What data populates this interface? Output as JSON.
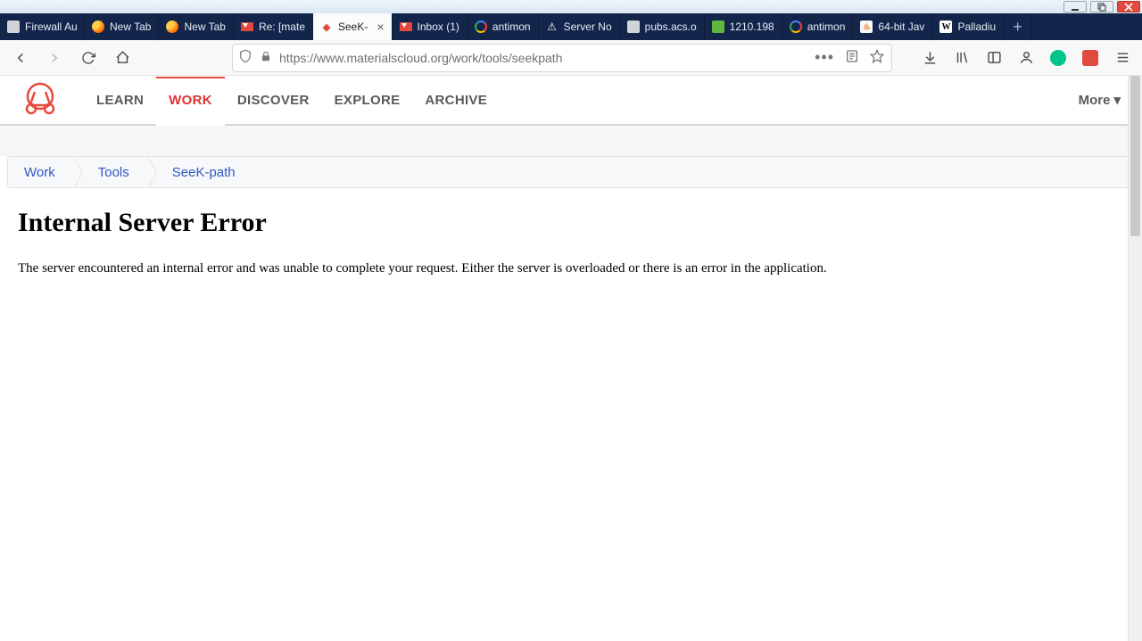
{
  "window": {
    "minimize_tip": "Minimize",
    "maximize_tip": "Restore",
    "close_tip": "Close"
  },
  "tabs": [
    {
      "label": "Firewall Auth",
      "favicon": "gen"
    },
    {
      "label": "New Tab",
      "favicon": "ff"
    },
    {
      "label": "New Tab",
      "favicon": "ff"
    },
    {
      "label": "Re: [mate",
      "favicon": "gmail"
    },
    {
      "label": "SeeK-",
      "favicon": "mc",
      "active": true,
      "closeable": true
    },
    {
      "label": "Inbox (1)",
      "favicon": "gmail"
    },
    {
      "label": "antimon",
      "favicon": "google"
    },
    {
      "label": "Server No",
      "favicon": "warn"
    },
    {
      "label": "pubs.acs.org",
      "favicon": "gen"
    },
    {
      "label": "1210.198",
      "favicon": "green"
    },
    {
      "label": "antimon",
      "favicon": "google"
    },
    {
      "label": "64-bit Jav",
      "favicon": "java"
    },
    {
      "label": "Palladiu",
      "favicon": "wiki"
    }
  ],
  "toolbar": {
    "url_protocol": "https://",
    "url_rest": "www.materialscloud.org/work/tools/seekpath"
  },
  "nav": {
    "items": [
      "LEARN",
      "WORK",
      "DISCOVER",
      "EXPLORE",
      "ARCHIVE"
    ],
    "active_index": 1,
    "more_label": "More"
  },
  "breadcrumbs": [
    "Work",
    "Tools",
    "SeeK-path"
  ],
  "error": {
    "title": "Internal Server Error",
    "body": "The server encountered an internal error and was unable to complete your request. Either the server is overloaded or there is an error in the application."
  }
}
